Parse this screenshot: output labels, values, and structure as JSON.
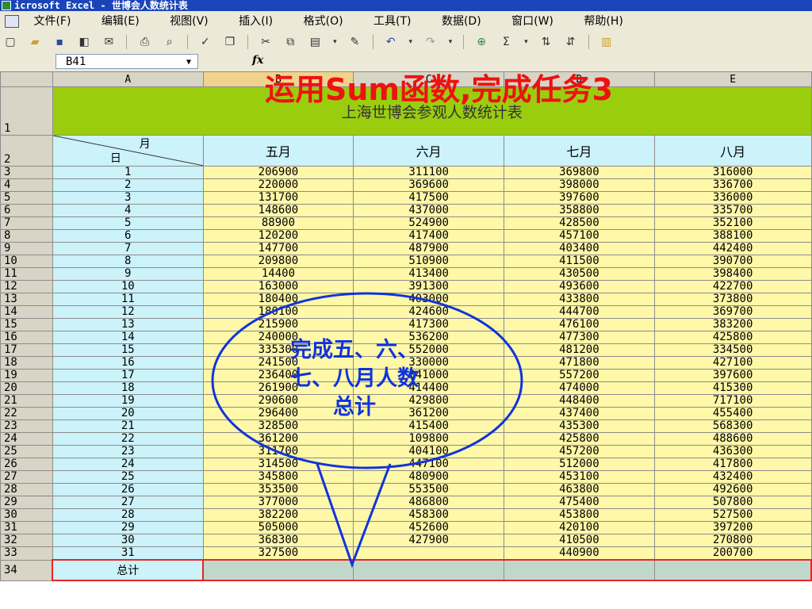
{
  "window": {
    "title": "icrosoft Excel - 世博会人数统计表"
  },
  "menu": [
    "文件(F)",
    "编辑(E)",
    "视图(V)",
    "插入(I)",
    "格式(O)",
    "工具(T)",
    "数据(D)",
    "窗口(W)",
    "帮助(H)"
  ],
  "formula_bar": {
    "name_box": "B41",
    "fx": "fx"
  },
  "columns": [
    "A",
    "B",
    "C",
    "D",
    "E"
  ],
  "overlay_title": "运用Sum函数,完成任务3",
  "sheet_title": "上海世博会参观人数统计表",
  "header": {
    "month_label": "月",
    "day_label": "日",
    "months": [
      "五月",
      "六月",
      "七月",
      "八月"
    ]
  },
  "rows": [
    {
      "r": "3",
      "d": "1",
      "v": [
        "206900",
        "311100",
        "369800",
        "316000"
      ]
    },
    {
      "r": "4",
      "d": "2",
      "v": [
        "220000",
        "369600",
        "398000",
        "336700"
      ]
    },
    {
      "r": "5",
      "d": "3",
      "v": [
        "131700",
        "417500",
        "397600",
        "336000"
      ]
    },
    {
      "r": "6",
      "d": "4",
      "v": [
        "148600",
        "437000",
        "358800",
        "335700"
      ]
    },
    {
      "r": "7",
      "d": "5",
      "v": [
        "88900",
        "524900",
        "428500",
        "352100"
      ]
    },
    {
      "r": "8",
      "d": "6",
      "v": [
        "120200",
        "417400",
        "457100",
        "388100"
      ]
    },
    {
      "r": "9",
      "d": "7",
      "v": [
        "147700",
        "487900",
        "403400",
        "442400"
      ]
    },
    {
      "r": "10",
      "d": "8",
      "v": [
        "209800",
        "510900",
        "411500",
        "390700"
      ]
    },
    {
      "r": "11",
      "d": "9",
      "v": [
        "14400",
        "413400",
        "430500",
        "398400"
      ]
    },
    {
      "r": "12",
      "d": "10",
      "v": [
        "163000",
        "391300",
        "493600",
        "422700"
      ]
    },
    {
      "r": "13",
      "d": "11",
      "v": [
        "180400",
        "403000",
        "433800",
        "373800"
      ]
    },
    {
      "r": "14",
      "d": "12",
      "v": [
        "180100",
        "424600",
        "444700",
        "369700"
      ]
    },
    {
      "r": "15",
      "d": "13",
      "v": [
        "215900",
        "417300",
        "476100",
        "383200"
      ]
    },
    {
      "r": "16",
      "d": "14",
      "v": [
        "240000",
        "536200",
        "477300",
        "425800"
      ]
    },
    {
      "r": "17",
      "d": "15",
      "v": [
        "335300",
        "552000",
        "481200",
        "334500"
      ]
    },
    {
      "r": "18",
      "d": "16",
      "v": [
        "241500",
        "330000",
        "471800",
        "427100"
      ]
    },
    {
      "r": "19",
      "d": "17",
      "v": [
        "236400",
        "341000",
        "557200",
        "397600"
      ]
    },
    {
      "r": "20",
      "d": "18",
      "v": [
        "261900",
        "414400",
        "474000",
        "415300"
      ]
    },
    {
      "r": "21",
      "d": "19",
      "v": [
        "290600",
        "429800",
        "448400",
        "717100"
      ]
    },
    {
      "r": "22",
      "d": "20",
      "v": [
        "296400",
        "361200",
        "437400",
        "455400"
      ]
    },
    {
      "r": "23",
      "d": "21",
      "v": [
        "328500",
        "415400",
        "435300",
        "568300"
      ]
    },
    {
      "r": "24",
      "d": "22",
      "v": [
        "361200",
        "109800",
        "425800",
        "488600"
      ]
    },
    {
      "r": "25",
      "d": "23",
      "v": [
        "311700",
        "404100",
        "457200",
        "436300"
      ]
    },
    {
      "r": "26",
      "d": "24",
      "v": [
        "314500",
        "447100",
        "512000",
        "417800"
      ]
    },
    {
      "r": "27",
      "d": "25",
      "v": [
        "345800",
        "480900",
        "453100",
        "432400"
      ]
    },
    {
      "r": "28",
      "d": "26",
      "v": [
        "353500",
        "553500",
        "463800",
        "492600"
      ]
    },
    {
      "r": "29",
      "d": "27",
      "v": [
        "377000",
        "486800",
        "475400",
        "507800"
      ]
    },
    {
      "r": "30",
      "d": "28",
      "v": [
        "382200",
        "458300",
        "453800",
        "527500"
      ]
    },
    {
      "r": "31",
      "d": "29",
      "v": [
        "505000",
        "452600",
        "420100",
        "397200"
      ]
    },
    {
      "r": "32",
      "d": "30",
      "v": [
        "368300",
        "427900",
        "410500",
        "270800"
      ]
    },
    {
      "r": "33",
      "d": "31",
      "v": [
        "327500",
        "",
        "440900",
        "200700"
      ]
    }
  ],
  "total_row": {
    "r": "34",
    "label": "总计"
  },
  "callout": {
    "line1": "完成五、六、",
    "line2": "七、八月人数",
    "line3": "总计",
    "color": "#1133dd"
  },
  "colors": {
    "title_bg": "#9acd0e",
    "col_a_bg": "#ccf2fa",
    "value_bg": "#fff8a8",
    "highlight": "#ee1111"
  }
}
